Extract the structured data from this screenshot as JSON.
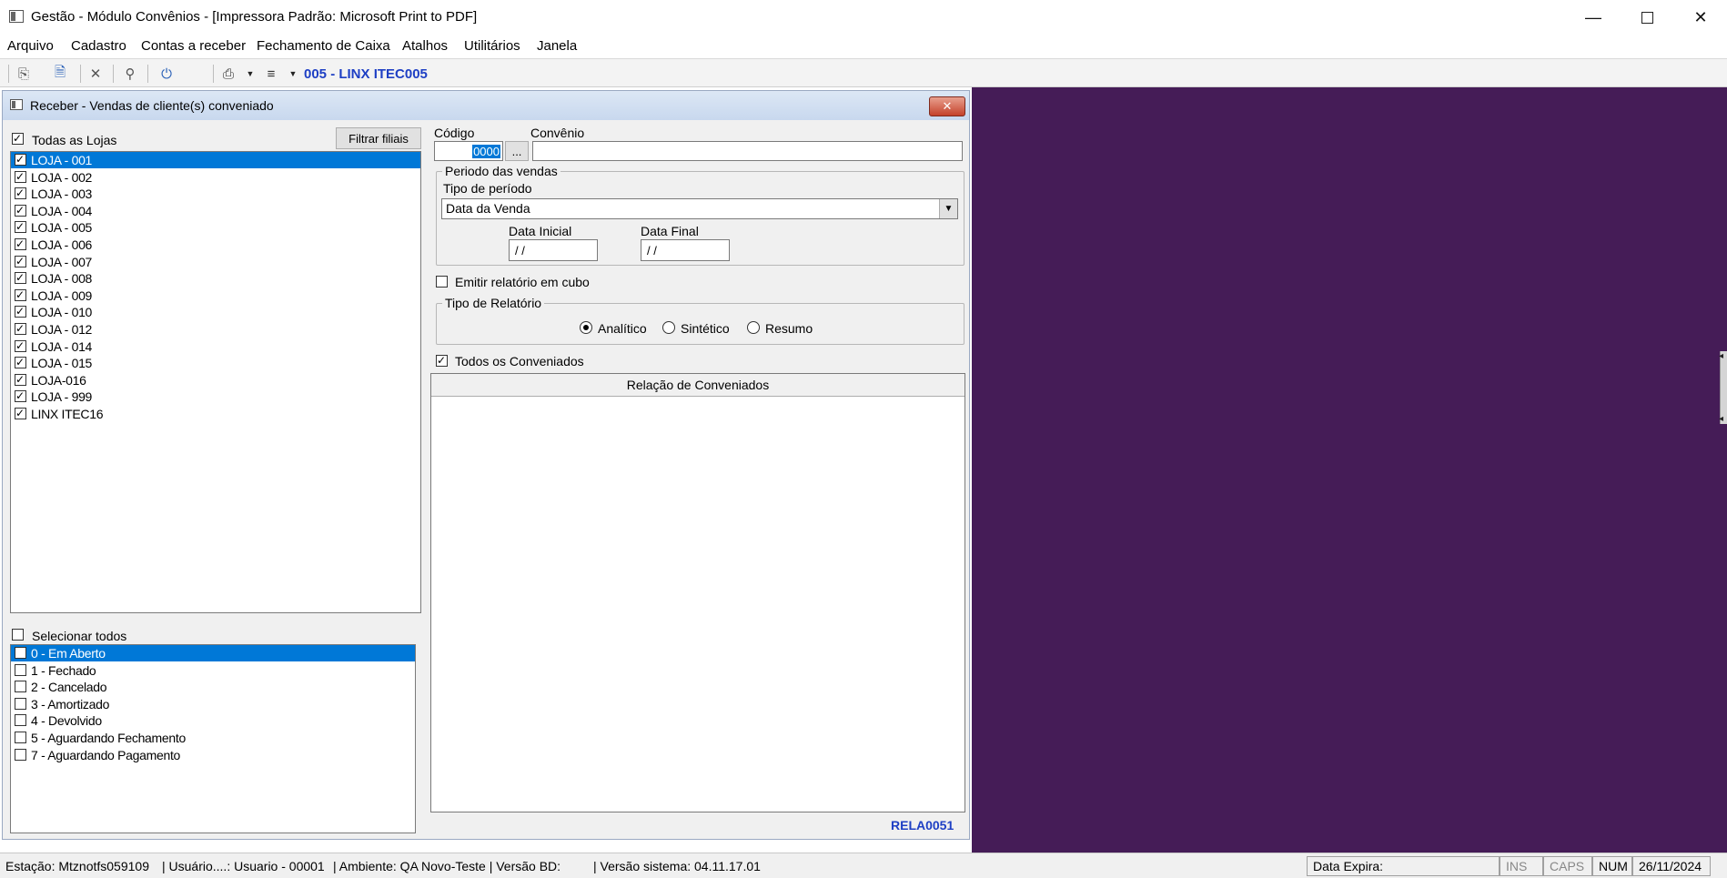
{
  "window": {
    "title": "Gestão  - Módulo Convênios - [Impressora Padrão: Microsoft Print to PDF]"
  },
  "menu": [
    "Arquivo",
    "Cadastro",
    "Contas a receber",
    "Fechamento de Caixa",
    "Atalhos",
    "Utilitários",
    "Janela"
  ],
  "toolbar": {
    "store_label": "005 - LINX ITEC005"
  },
  "dialog": {
    "title": "Receber - Vendas de cliente(s) conveniado",
    "close_label": "✕",
    "all_stores_label": "Todas as Lojas",
    "filter_button": "Filtrar filiais",
    "stores": [
      {
        "label": "LOJA - 001",
        "checked": true
      },
      {
        "label": "LOJA - 002",
        "checked": true
      },
      {
        "label": "LOJA - 003",
        "checked": true
      },
      {
        "label": "LOJA - 004",
        "checked": true
      },
      {
        "label": "LOJA - 005",
        "checked": true
      },
      {
        "label": "LOJA - 006",
        "checked": true
      },
      {
        "label": "LOJA - 007",
        "checked": true
      },
      {
        "label": "LOJA - 008",
        "checked": true
      },
      {
        "label": "LOJA - 009",
        "checked": true
      },
      {
        "label": "LOJA - 010",
        "checked": true
      },
      {
        "label": "LOJA - 012",
        "checked": true
      },
      {
        "label": "LOJA - 014",
        "checked": true
      },
      {
        "label": "LOJA - 015",
        "checked": true
      },
      {
        "label": "LOJA-016",
        "checked": true
      },
      {
        "label": "LOJA - 999",
        "checked": true
      },
      {
        "label": "LINX ITEC16",
        "checked": true
      }
    ],
    "select_all_label": "Selecionar todos",
    "statuses": [
      {
        "label": "0 - Em Aberto",
        "checked": false
      },
      {
        "label": "1 - Fechado",
        "checked": false
      },
      {
        "label": "2 - Cancelado",
        "checked": false
      },
      {
        "label": "3 - Amortizado",
        "checked": false
      },
      {
        "label": "4 - Devolvido",
        "checked": false
      },
      {
        "label": "5 - Aguardando Fechamento",
        "checked": false
      },
      {
        "label": "7 - Aguardando Pagamento",
        "checked": false
      }
    ],
    "codigo_label": "Código",
    "codigo_value": "0000",
    "lookup_button": "...",
    "convenio_label": "Convênio",
    "convenio_value": "",
    "period_group": "Periodo das vendas",
    "period_type_label": "Tipo de período",
    "period_type_value": "Data da Venda",
    "start_date_label": "Data Inicial",
    "start_date_value": " /  /",
    "end_date_label": "Data Final",
    "end_date_value": " /  /",
    "cube_report_label": "Emitir relatório em cubo",
    "report_type_group": "Tipo de Relatório",
    "report_types": [
      "Analítico",
      "Sintético",
      "Resumo"
    ],
    "all_members_label": "Todos os Conveniados",
    "members_header": "Relação de Conveniados",
    "form_code": "RELA0051"
  },
  "status_bar": {
    "station": "Estação: Mtznotfs059109",
    "user": "| Usuário....: Usuario - 00001",
    "env": "| Ambiente: QA Novo-Teste | Versão BD:",
    "version": "| Versão sistema: 04.11.17.01",
    "expire": "Data Expira:",
    "ins": "INS",
    "caps": "CAPS",
    "num": "NUM",
    "date": "26/11/2024"
  }
}
